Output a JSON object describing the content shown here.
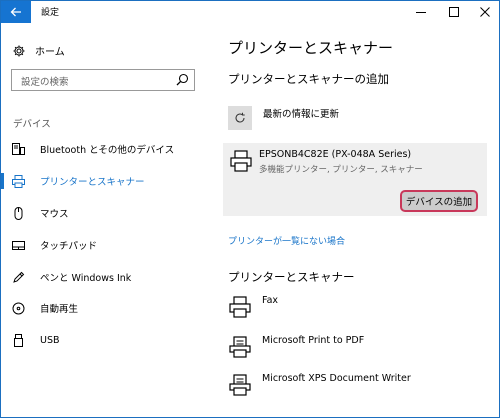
{
  "window": {
    "title": "設定"
  },
  "sidebar": {
    "home_label": "ホーム",
    "search_placeholder": "設定の検索",
    "section_label": "デバイス",
    "items": [
      {
        "label": "Bluetooth とその他のデバイス",
        "icon": "bluetooth-devices-icon",
        "selected": false
      },
      {
        "label": "プリンターとスキャナー",
        "icon": "printer-icon",
        "selected": true
      },
      {
        "label": "マウス",
        "icon": "mouse-icon",
        "selected": false
      },
      {
        "label": "タッチパッド",
        "icon": "touchpad-icon",
        "selected": false
      },
      {
        "label": "ペンと Windows Ink",
        "icon": "pen-icon",
        "selected": false
      },
      {
        "label": "自動再生",
        "icon": "autoplay-icon",
        "selected": false
      },
      {
        "label": "USB",
        "icon": "usb-icon",
        "selected": false
      }
    ]
  },
  "main": {
    "page_title": "プリンターとスキャナー",
    "add_section_title": "プリンターとスキャナーの追加",
    "refresh_label": "最新の情報に更新",
    "found_device": {
      "name": "EPSONB4C82E (PX-048A Series)",
      "description": "多機能プリンター, プリンター, スキャナー",
      "add_button_label": "デバイスの追加"
    },
    "not_listed_link": "プリンターが一覧にない場合",
    "printers_section_title": "プリンターとスキャナー",
    "printers": [
      {
        "name": "Fax"
      },
      {
        "name": "Microsoft Print to PDF"
      },
      {
        "name": "Microsoft XPS Document Writer"
      }
    ]
  },
  "colors": {
    "accent": "#1874c9",
    "back_button": "#1674d1",
    "highlight_border": "#c8385a",
    "card_background": "#efefef"
  }
}
